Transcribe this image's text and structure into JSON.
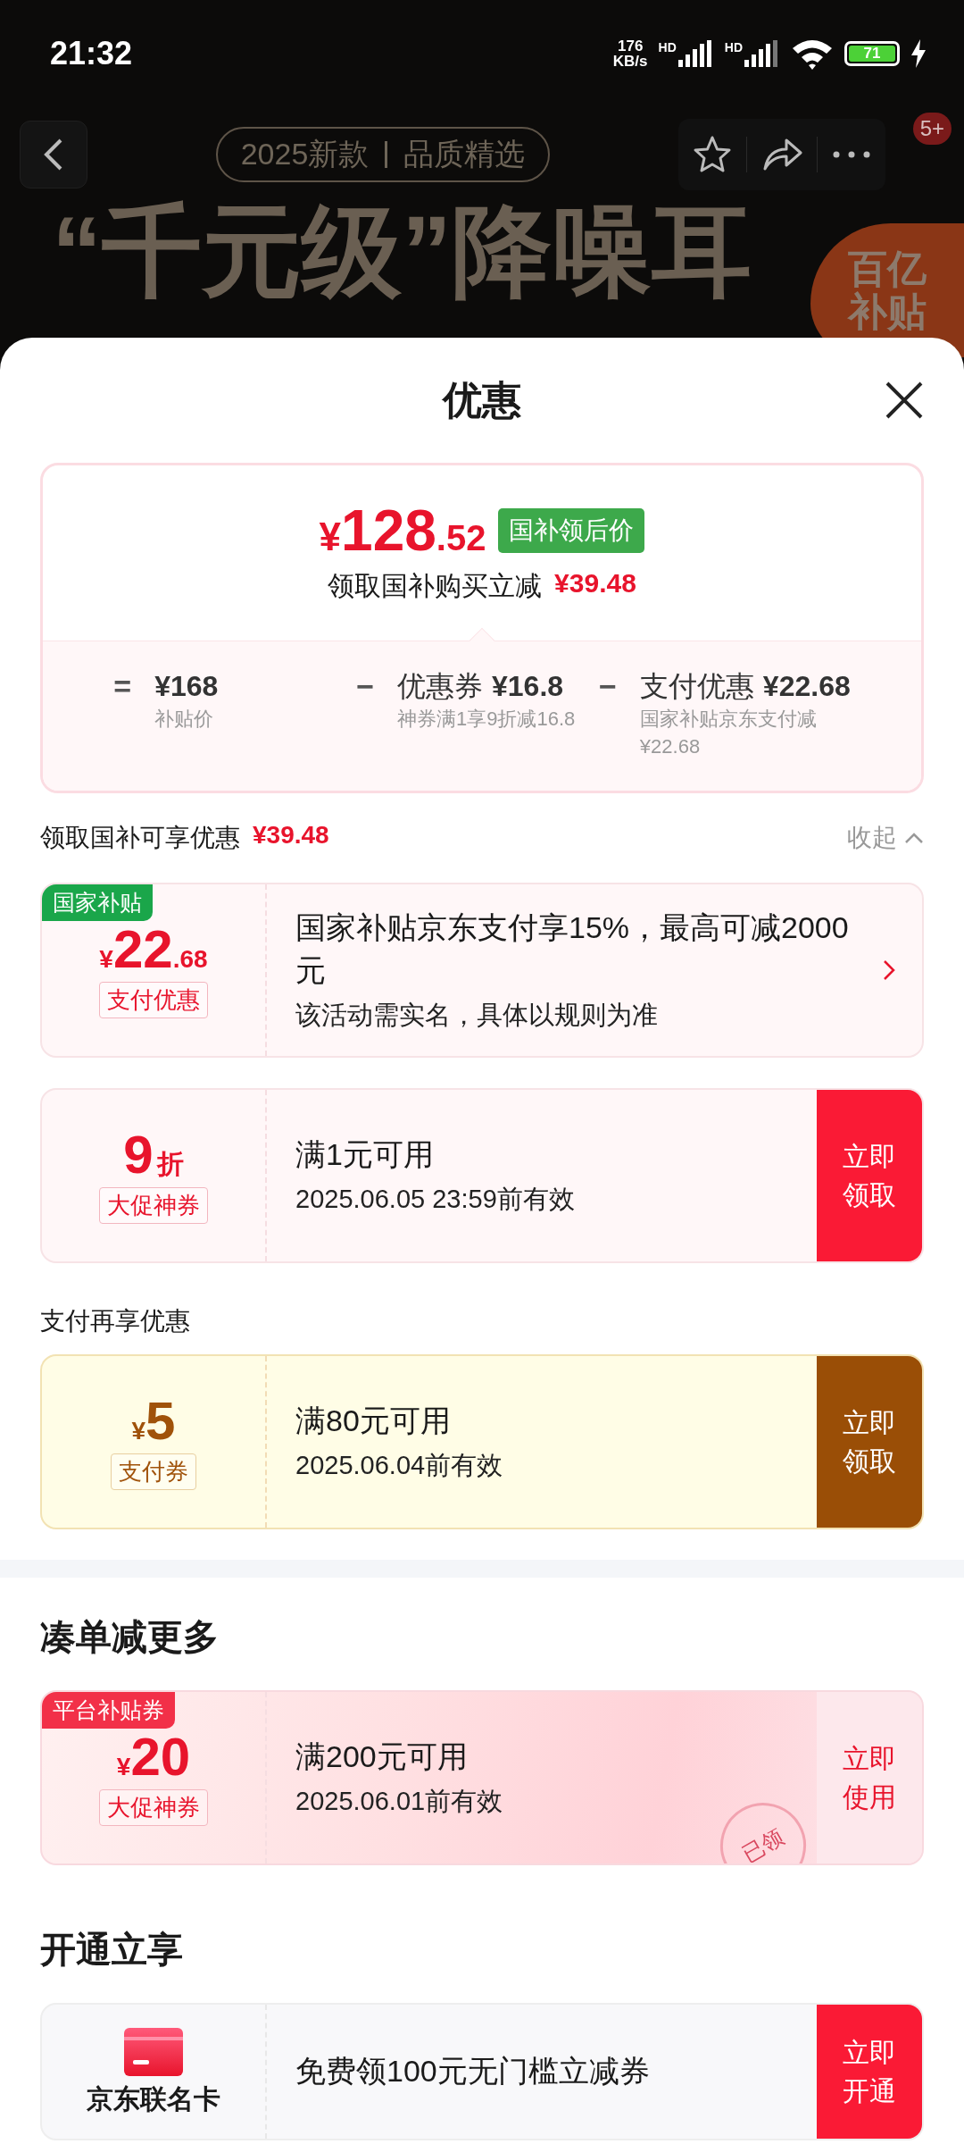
{
  "status_bar": {
    "time": "21:32",
    "speed_value": "176",
    "speed_unit": "KB/s",
    "signal_labels": [
      "HD",
      "HD"
    ],
    "battery": "71",
    "charging": true
  },
  "banner": {
    "tag_parts": [
      "2025新款",
      "品质精选"
    ],
    "headline": "“千元级”降噪耳",
    "badge_lines": [
      "百亿",
      "补贴"
    ],
    "notification": "5+"
  },
  "sheet": {
    "title": "优惠"
  },
  "price_summary": {
    "currency": "¥",
    "price_main": "128",
    "price_decimal": ".52",
    "tag": "国补领后价",
    "saving_label": "领取国补购买立减",
    "saving_amount": "¥39.48",
    "breakdown": [
      {
        "op": "=",
        "amount": "¥168",
        "note": "补贴价"
      },
      {
        "op": "−",
        "label": "优惠券",
        "amount": "¥16.8",
        "note": "神券满1享9折减16.8"
      },
      {
        "op": "−",
        "label": "支付优惠",
        "amount": "¥22.68",
        "note": "国家补贴京东支付减¥22.68"
      }
    ]
  },
  "offers": {
    "label": "领取国补可享优惠",
    "amount": "¥39.48",
    "toggle": "收起",
    "expanded": true,
    "coupons": [
      {
        "kind": "subsidy",
        "corner_tag": "国家补贴",
        "currency": "¥",
        "amount": "22",
        "decimal": ".68",
        "type_label": "支付优惠",
        "title": "国家补贴京东支付享15%，最高可减2000元",
        "subtitle": "该活动需实名，具体以规则为准"
      },
      {
        "kind": "voucher",
        "amount": "9",
        "unit": "折",
        "type_label": "大促神券",
        "title": "满1元可用",
        "subtitle": "2025.06.05 23:59前有效",
        "button": "立即领取"
      }
    ]
  },
  "pay_section": {
    "title": "支付再享优惠",
    "coupons": [
      {
        "kind": "paycoupon",
        "currency": "¥",
        "amount": "5",
        "type_label": "支付券",
        "title": "满80元可用",
        "subtitle": "2025.06.04前有效",
        "button": "立即领取"
      }
    ]
  },
  "more_section": {
    "title": "凑单减更多",
    "coupons": [
      {
        "kind": "platform",
        "corner_tag": "平台补贴券",
        "currency": "¥",
        "amount": "20",
        "type_label": "大促神券",
        "title": "满200元可用",
        "subtitle": "2025.06.01前有效",
        "button": "立即使用",
        "stamp": "已领"
      }
    ]
  },
  "open_section": {
    "title": "开通立享",
    "card": {
      "label": "京东联名卡",
      "title": "免费领100元无门槛立减券",
      "button": "立即开通"
    }
  }
}
